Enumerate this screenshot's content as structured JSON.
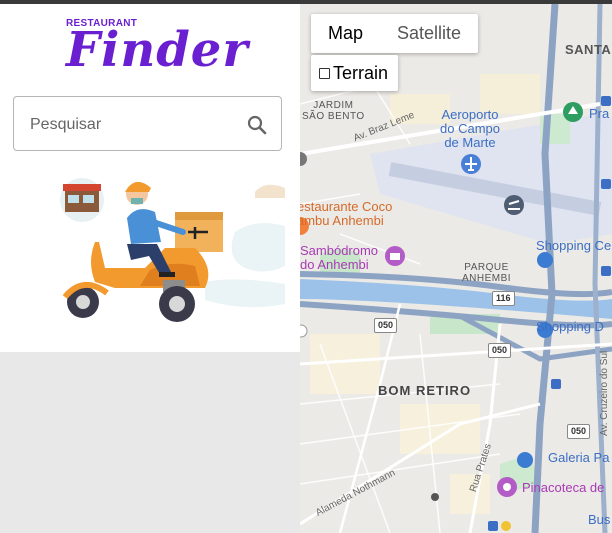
{
  "logo": {
    "small": "RESTAURANT",
    "big": "Finder"
  },
  "search": {
    "placeholder": "Pesquisar",
    "value": ""
  },
  "map": {
    "type_buttons": [
      "Map",
      "Satellite"
    ],
    "selected_type": "Map",
    "terrain_label": "Terrain",
    "labels": {
      "santa": "SANTA",
      "jardim_sao_bento": "JARDIM\nSÃO BENTO",
      "av_braz_leme": "Av. Braz Leme",
      "aeroporto": "Aeroporto\ndo Campo\nde Marte",
      "praca": "Pra",
      "restaurante": "estaurante Coco\nambu Anhembi",
      "sambodromo": "Sambódromo\ndo Anhembi",
      "parque_anhembi": "PARQUE\nANHEMBI",
      "shopping_ce": "Shopping Ce",
      "shopping_d": "Shopping D",
      "bom_retiro": "BOM RETIRO",
      "galeria": "Galeria Pa",
      "pinacoteca": "Pinacoteca de",
      "alameda_nothmann": "Alameda Nothmann",
      "rua_prates": "Rua Prates",
      "av_cruzeiro": "Av. Cruzeiro do Sul",
      "bus": "Bus"
    },
    "shields": {
      "r116": "116",
      "r050a": "050",
      "r050b": "050",
      "r050c": "050"
    }
  }
}
